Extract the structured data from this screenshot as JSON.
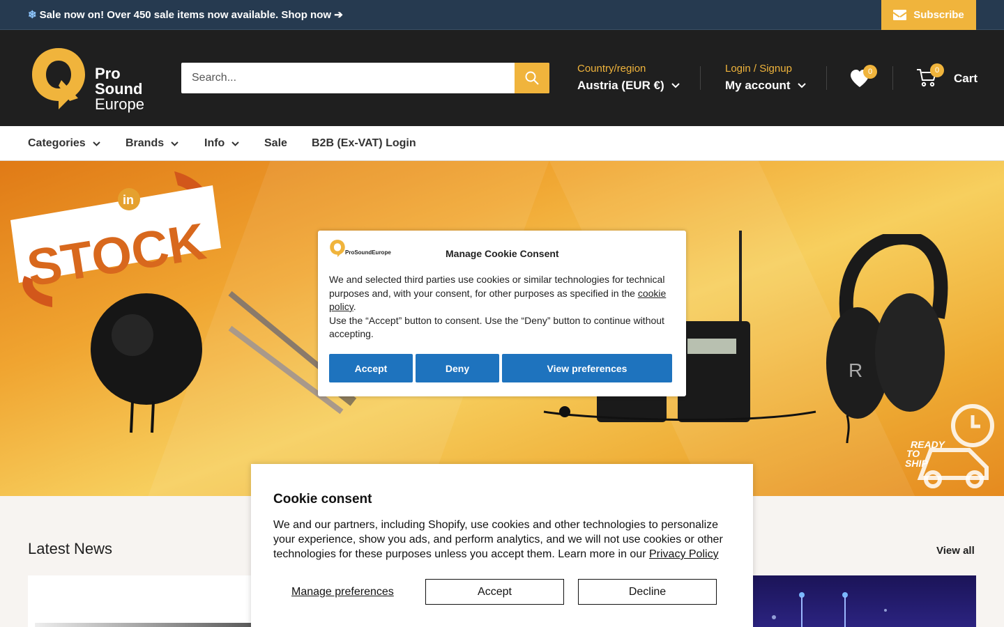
{
  "announcement": {
    "icon": "snowflake-icon",
    "text": "Sale now on! Over 450 sale items now available. Shop now ➔",
    "subscribe_label": "Subscribe"
  },
  "header": {
    "logo_words": [
      "Pro",
      "Sound",
      "Europe"
    ],
    "search_placeholder": "Search...",
    "country_label": "Country/region",
    "country_value": "Austria (EUR €)",
    "login_label": "Login / Signup",
    "account_label": "My account",
    "wishlist_count": "0",
    "cart_count": "0",
    "cart_label": "Cart"
  },
  "nav": {
    "items": [
      {
        "label": "Categories",
        "dropdown": true
      },
      {
        "label": "Brands",
        "dropdown": true
      },
      {
        "label": "Info",
        "dropdown": true
      },
      {
        "label": "Sale",
        "dropdown": false
      },
      {
        "label": "B2B (Ex-VAT) Login",
        "dropdown": false
      }
    ]
  },
  "hero": {
    "banner_word": "STOCK",
    "banner_badge": "in",
    "ship_text": [
      "READY",
      "TO",
      "SHIP"
    ]
  },
  "news": {
    "title": "Latest News",
    "view_all": "View all"
  },
  "manage_modal": {
    "logo_text": "ProSoundEurope",
    "title": "Manage Cookie Consent",
    "body_part1": "We and selected third parties use cookies or similar technologies for technical purposes and, with your consent, for other purposes as specified in the ",
    "body_link": "cookie policy",
    "body_part2": ".",
    "body_line2": "Use the “Accept” button to consent. Use the “Deny” button to continue without accepting.",
    "accept_label": "Accept",
    "deny_label": "Deny",
    "preferences_label": "View preferences"
  },
  "cookie_panel": {
    "title": "Cookie consent",
    "body": "We and our partners, including Shopify, use cookies and other technologies to personalize your experience, show you ads, and perform analytics, and we will not use cookies or other technologies for these purposes unless you accept them. Learn more in our ",
    "privacy_link": "Privacy Policy",
    "manage_label": "Manage preferences",
    "accept_label": "Accept",
    "decline_label": "Decline"
  },
  "colors": {
    "accent": "#f0b43c",
    "announcement_bg": "#263a50",
    "header_bg": "#1f1f1f",
    "consent_button": "#1e73be"
  }
}
